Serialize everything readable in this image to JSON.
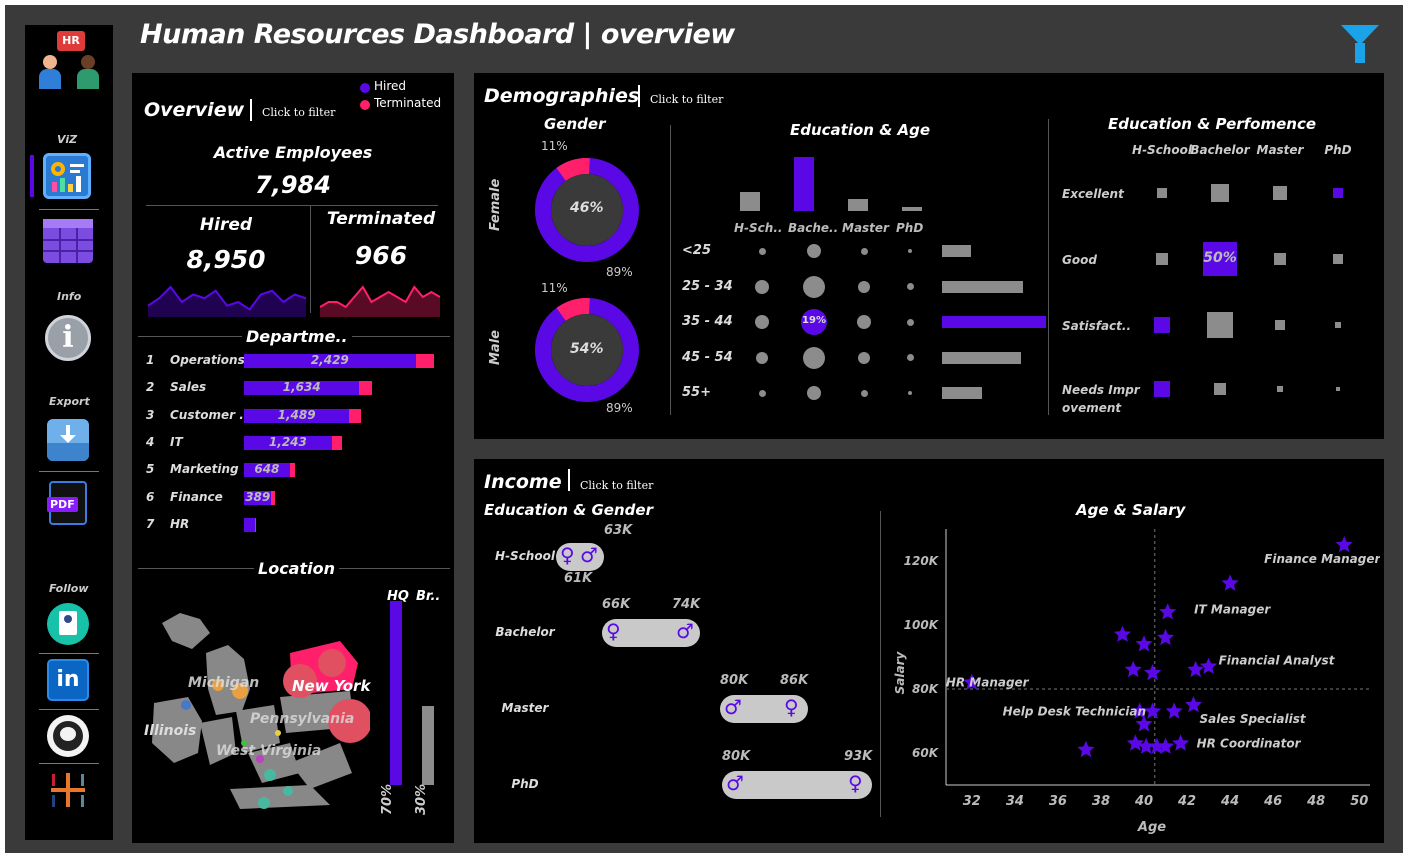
{
  "title": "Human Resources Dashboard | overview",
  "colors": {
    "purple": "#5a09e6",
    "pink": "#ff1f6b",
    "grey": "#8c8c8c",
    "dark": "#3a3a3a"
  },
  "sidebar": {
    "logo_text": "HR",
    "sections": {
      "viz": "ViZ",
      "info": "Info",
      "export": "Export",
      "follow": "Follow"
    },
    "icons": [
      "dashboard-icon",
      "table-icon",
      "info-icon",
      "image-export-icon",
      "pdf-export-icon",
      "profile-icon",
      "linkedin-icon",
      "github-icon",
      "tableau-icon"
    ],
    "pdf_label": "PDF",
    "linkedin_label": "in"
  },
  "overview": {
    "title": "Overview",
    "click": "Click to filter",
    "legend": {
      "hired": "Hired",
      "terminated": "Terminated"
    },
    "active_label": "Active Employees",
    "active_value": "7,984",
    "hired_label": "Hired",
    "hired_value": "8,950",
    "terminated_label": "Terminated",
    "terminated_value": "966",
    "hired_trend": [
      3,
      5,
      8,
      4,
      6,
      5,
      7,
      3,
      4,
      2,
      6,
      7,
      4,
      6,
      5
    ],
    "terminated_trend": [
      2,
      3,
      3,
      2,
      4,
      6,
      3,
      4,
      5,
      4,
      3,
      6,
      4,
      5,
      4
    ],
    "dept_title": "Departme..",
    "departments": [
      {
        "rank": "1",
        "name": "Operations",
        "value": "2,429",
        "hired": 2429,
        "term": 260
      },
      {
        "rank": "2",
        "name": "Sales",
        "value": "1,634",
        "hired": 1634,
        "term": 180
      },
      {
        "rank": "3",
        "name": "Customer ..",
        "value": "1,489",
        "hired": 1489,
        "term": 165
      },
      {
        "rank": "4",
        "name": "IT",
        "value": "1,243",
        "hired": 1243,
        "term": 140
      },
      {
        "rank": "5",
        "name": "Marketing",
        "value": "648",
        "hired": 648,
        "term": 75
      },
      {
        "rank": "6",
        "name": "Finance",
        "value": "389",
        "hired": 389,
        "term": 45
      },
      {
        "rank": "7",
        "name": "HR",
        "value": "",
        "hired": 150,
        "term": 15
      }
    ],
    "location_title": "Location",
    "states": [
      "Michigan",
      "New York",
      "Illinois",
      "Pennsylvania",
      "West Virginia"
    ],
    "hq_label": "HQ",
    "br_label": "Br..",
    "hq_pct": "70%",
    "br_pct": "30%",
    "hq_value": 0.7,
    "br_value": 0.3
  },
  "demographics": {
    "title": "Demographies",
    "click": "Click to filter",
    "gender_title": "Gender",
    "female": {
      "label": "Female",
      "pct": "46%",
      "terminated": "11%",
      "hired": "89%"
    },
    "male": {
      "label": "Male",
      "pct": "54%",
      "terminated": "11%",
      "hired": "89%"
    },
    "edu_age_title": "Education & Age",
    "edu_levels": [
      "H-Sch..",
      "Bache..",
      "Master",
      "PhD"
    ],
    "edu_bar_values": [
      0.35,
      1.0,
      0.22,
      0.08
    ],
    "age_groups": [
      "<25",
      "25 - 34",
      "35 - 44",
      "45 - 54",
      "55+"
    ],
    "age_bar_values": [
      0.28,
      0.78,
      1.0,
      0.76,
      0.38
    ],
    "highlight_bubble": "19%",
    "edu_perf_title": "Education & Perfomence",
    "perf_cols": [
      "H-School",
      "Bachelor",
      "Master",
      "PhD"
    ],
    "perf_rows": [
      "Excellent",
      "Good",
      "Satisfact..",
      "Needs Impr ovement"
    ],
    "perf_highlight": "50%"
  },
  "income": {
    "title": "Income",
    "click": "Click to filter",
    "edu_gender_title": "Education & Gender",
    "rows": [
      {
        "label": "H-School",
        "low": "61K",
        "high": "63K"
      },
      {
        "label": "Bachelor",
        "low": "66K",
        "high": "74K"
      },
      {
        "label": "Master",
        "low": "80K",
        "high": "86K"
      },
      {
        "label": "PhD",
        "low": "80K",
        "high": "93K"
      }
    ],
    "female_symbol": "♀",
    "male_symbol": "♂",
    "age_salary_title": "Age & Salary"
  },
  "chart_data": {
    "type": "scatter",
    "title": "Age & Salary",
    "xlabel": "Age",
    "ylabel": "Salary",
    "xlim": [
      30.8,
      50.5
    ],
    "ylim": [
      50000,
      130000
    ],
    "x_ticks": [
      "32",
      "34",
      "36",
      "38",
      "40",
      "42",
      "44",
      "46",
      "48",
      "50"
    ],
    "y_ticks": [
      "60K",
      "80K",
      "100K",
      "120K"
    ],
    "points": [
      {
        "x": 49.3,
        "y": 125000,
        "label": "Finance Manager"
      },
      {
        "x": 44.0,
        "y": 113000,
        "label": "IT Manager"
      },
      {
        "x": 41.1,
        "y": 104000,
        "label": ""
      },
      {
        "x": 39.0,
        "y": 97000,
        "label": ""
      },
      {
        "x": 40.0,
        "y": 94000,
        "label": ""
      },
      {
        "x": 41.0,
        "y": 96000,
        "label": ""
      },
      {
        "x": 43.0,
        "y": 87000,
        "label": "Financial Analyst"
      },
      {
        "x": 42.4,
        "y": 86000,
        "label": ""
      },
      {
        "x": 39.5,
        "y": 86000,
        "label": ""
      },
      {
        "x": 40.4,
        "y": 85000,
        "label": ""
      },
      {
        "x": 32.0,
        "y": 82000,
        "label": "HR Manager"
      },
      {
        "x": 42.3,
        "y": 75000,
        "label": "Sales Specialist"
      },
      {
        "x": 41.4,
        "y": 73000,
        "label": ""
      },
      {
        "x": 39.8,
        "y": 73000,
        "label": ""
      },
      {
        "x": 40.4,
        "y": 73000,
        "label": "Help Desk Technician"
      },
      {
        "x": 40.0,
        "y": 69000,
        "label": ""
      },
      {
        "x": 39.6,
        "y": 63000,
        "label": ""
      },
      {
        "x": 40.1,
        "y": 62000,
        "label": ""
      },
      {
        "x": 40.6,
        "y": 62000,
        "label": ""
      },
      {
        "x": 41.0,
        "y": 62000,
        "label": ""
      },
      {
        "x": 41.7,
        "y": 63000,
        "label": "HR Coordinator"
      },
      {
        "x": 37.3,
        "y": 61000,
        "label": ""
      }
    ]
  }
}
